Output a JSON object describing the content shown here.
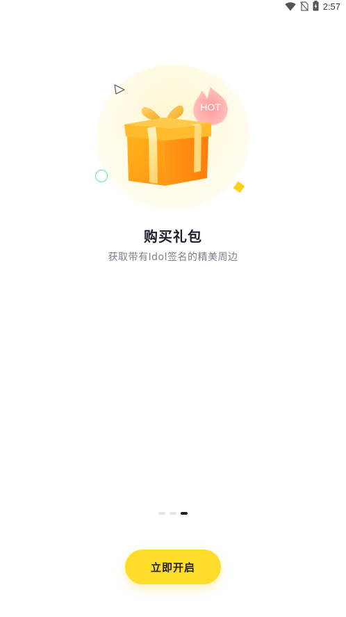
{
  "status_bar": {
    "time": "2:57",
    "icons": [
      "wifi-icon",
      "no-sim-icon",
      "battery-charging-icon"
    ]
  },
  "onboarding": {
    "illustration": {
      "icon": "gift-box-icon",
      "badge_text": "HOT"
    },
    "title": "购买礼包",
    "subtitle": "获取带有Idol签名的精美周边"
  },
  "pager": {
    "total": 3,
    "active_index": 2
  },
  "actions": {
    "start_label": "立即开启"
  },
  "colors": {
    "accent": "#fedc29",
    "title_text": "#1d1f2c",
    "subtitle_text": "#7c7f8c",
    "dot_active": "#1b1e2b",
    "dot_inactive": "#e3e4e8"
  }
}
